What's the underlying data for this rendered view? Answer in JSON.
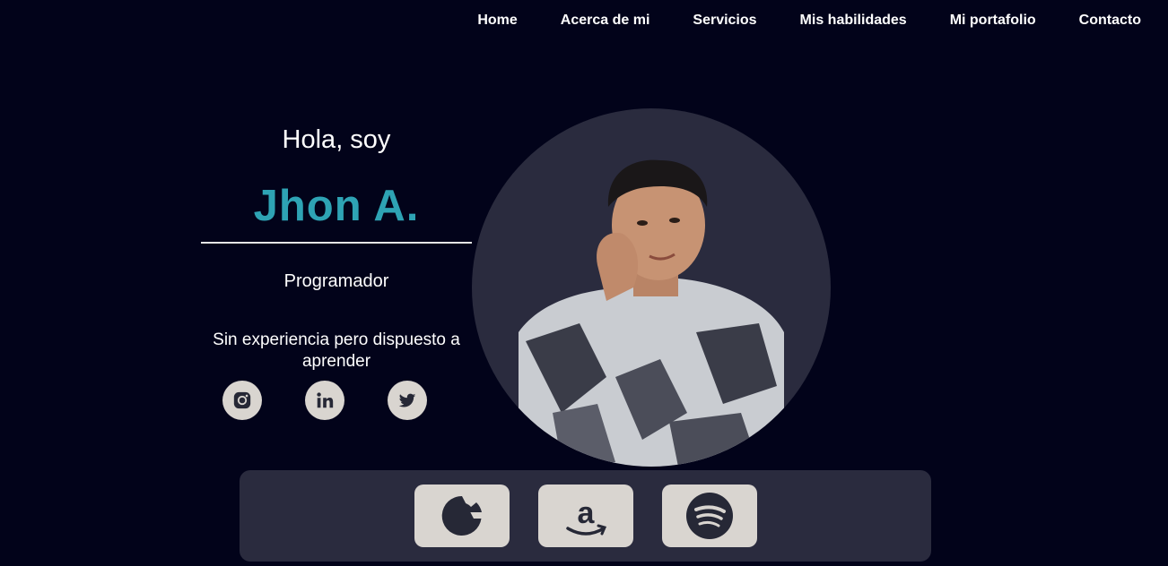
{
  "nav": {
    "items": [
      {
        "label": "Home"
      },
      {
        "label": "Acerca de mi"
      },
      {
        "label": "Servicios"
      },
      {
        "label": "Mis habilidades"
      },
      {
        "label": "Mi portafolio"
      },
      {
        "label": "Contacto"
      }
    ]
  },
  "hero": {
    "greeting": "Hola, soy",
    "name": "Jhon A.",
    "role": "Programador",
    "tagline": "Sin experiencia pero dispuesto a aprender"
  },
  "socials": [
    {
      "icon": "instagram-icon"
    },
    {
      "icon": "linkedin-icon"
    },
    {
      "icon": "twitter-icon"
    }
  ],
  "dock": [
    {
      "icon": "google-icon"
    },
    {
      "icon": "amazon-icon"
    },
    {
      "icon": "spotify-icon"
    }
  ],
  "colors": {
    "background": "#02031a",
    "accent": "#2ea3b4",
    "panel": "#2a2b3e",
    "icon_bg": "#d9d5d0",
    "icon_fg": "#262836"
  }
}
